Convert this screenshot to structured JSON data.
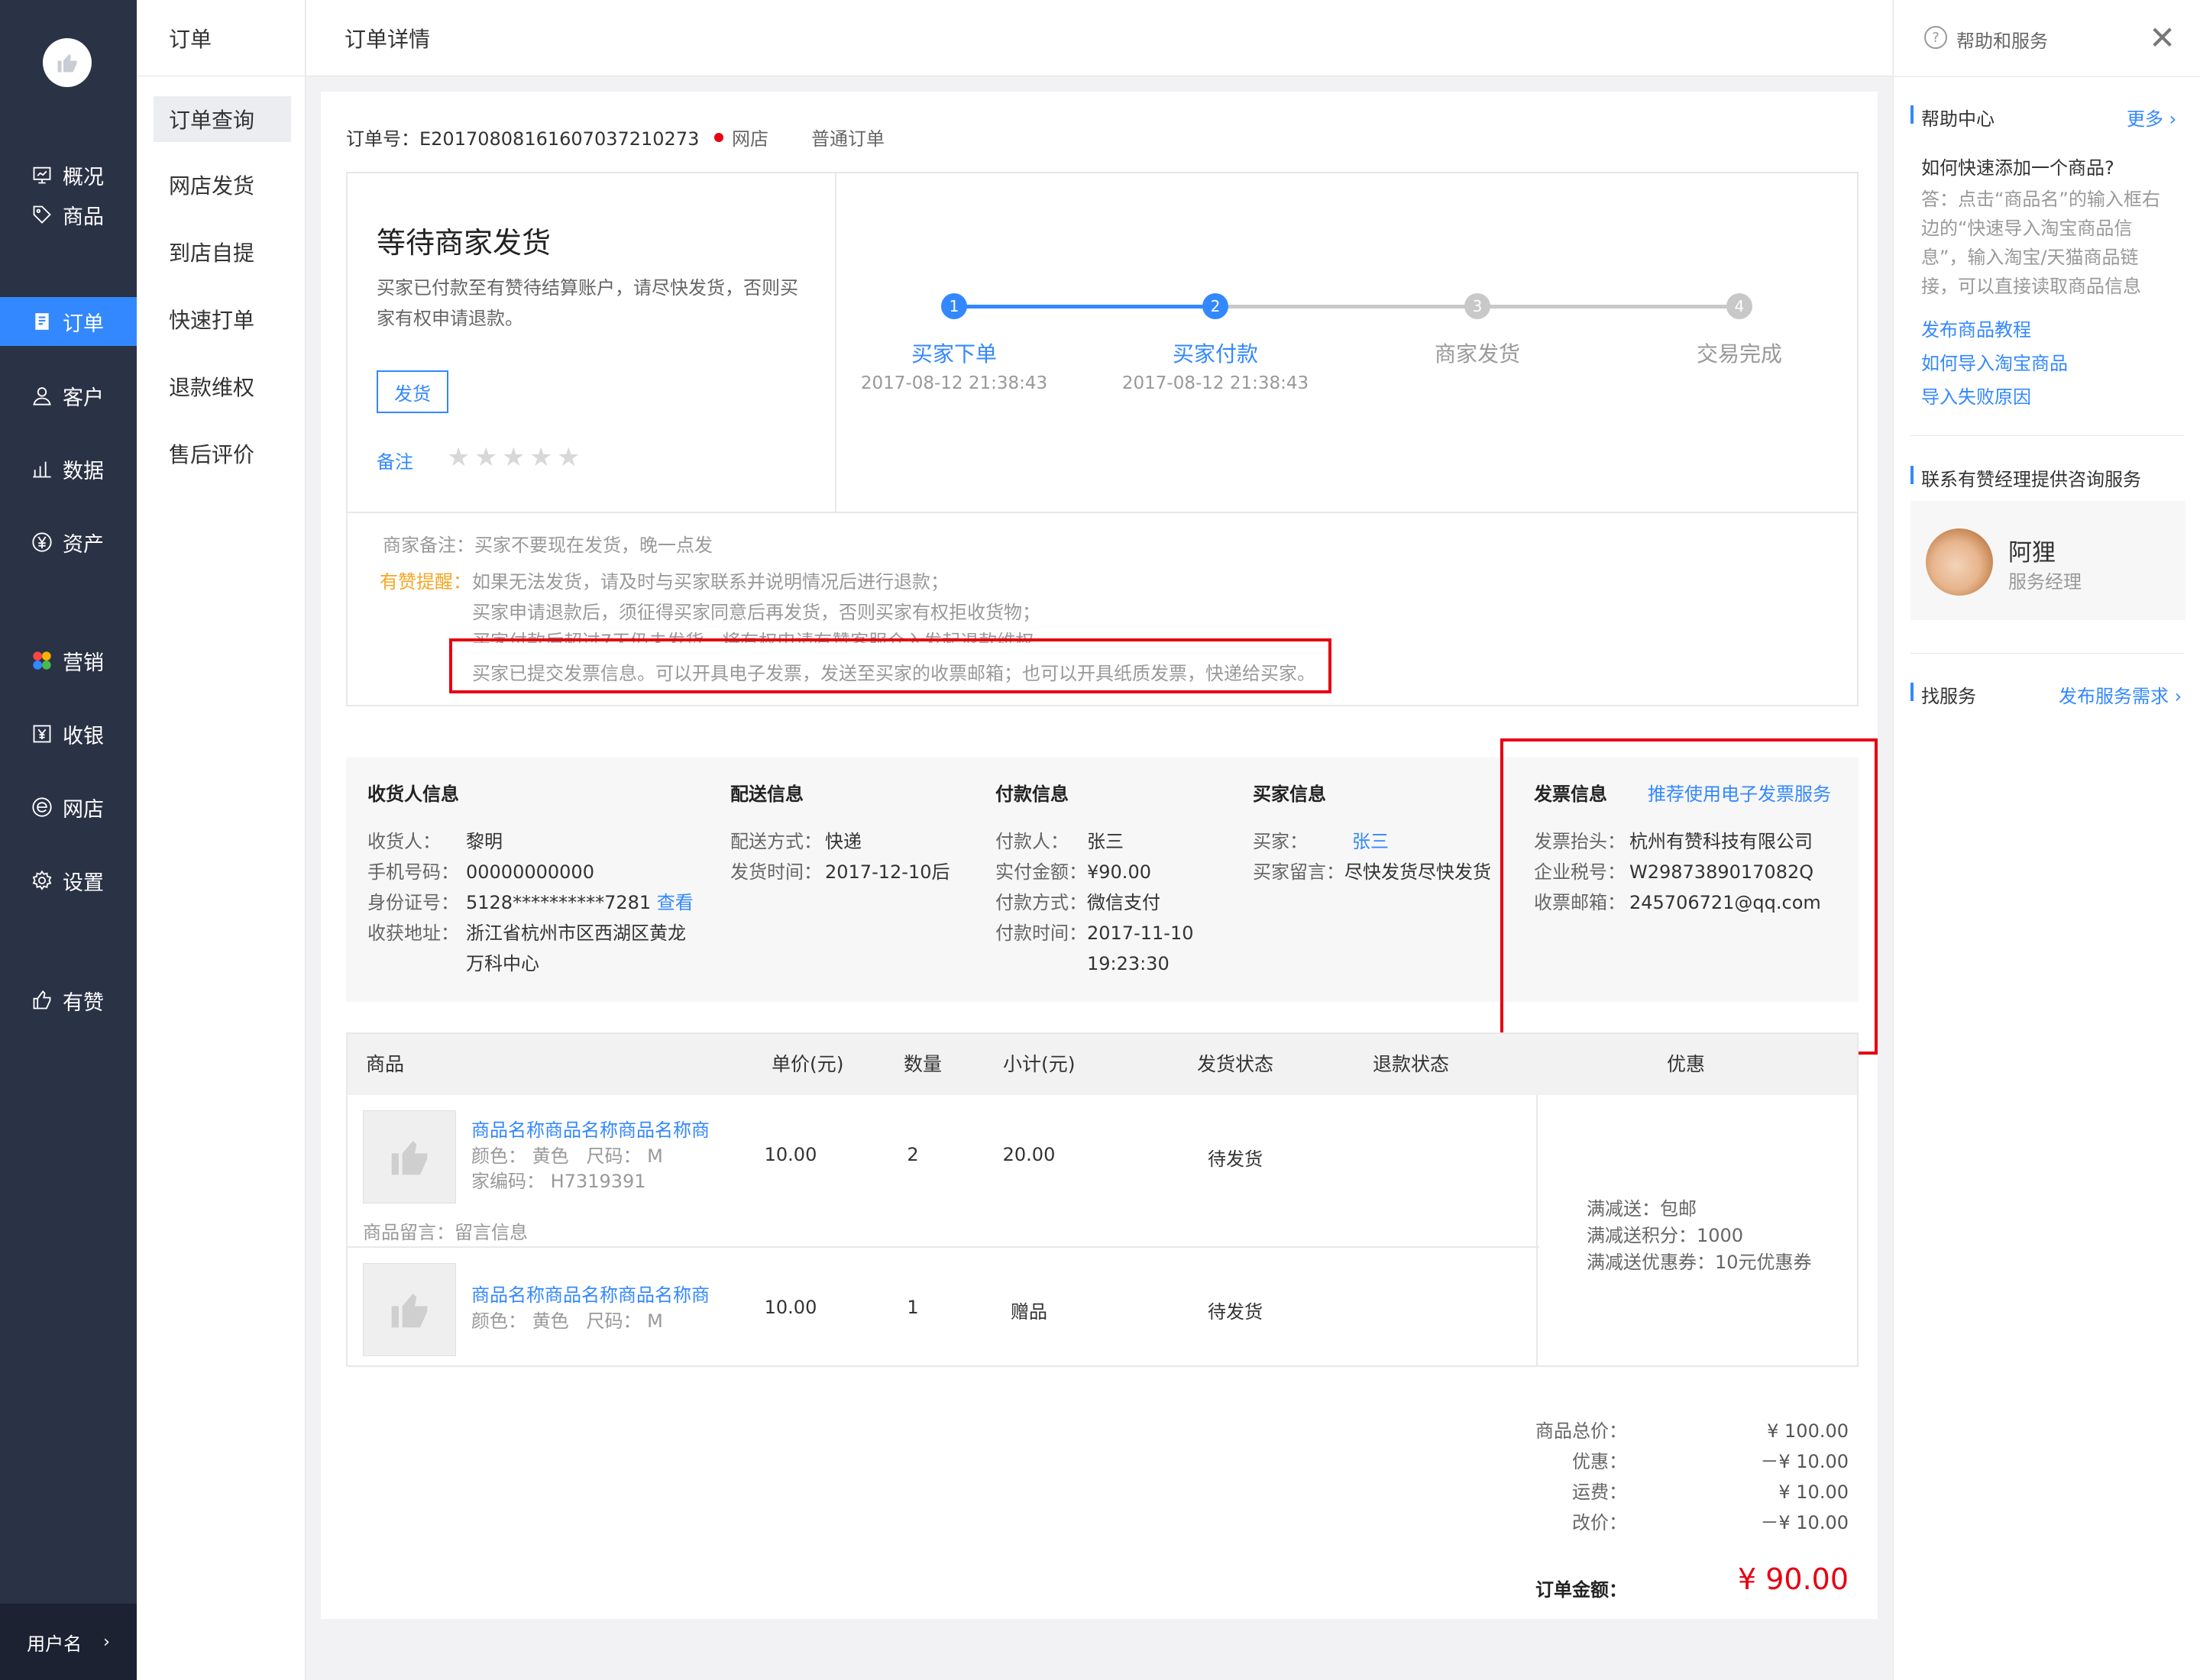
{
  "app": {
    "user_name": "用户名"
  },
  "nav": {
    "items": [
      {
        "label": "概况",
        "icon": "monitor-icon"
      },
      {
        "label": "商品",
        "icon": "tag-icon"
      },
      {
        "label": "订单",
        "icon": "order-icon"
      },
      {
        "label": "客户",
        "icon": "user-icon"
      },
      {
        "label": "数据",
        "icon": "bar-chart-icon"
      },
      {
        "label": "资产",
        "icon": "yen-icon"
      },
      {
        "label": "营销",
        "icon": "apps-icon"
      },
      {
        "label": "收银",
        "icon": "cashier-icon"
      },
      {
        "label": "网店",
        "icon": "store-icon"
      },
      {
        "label": "设置",
        "icon": "gear-icon"
      },
      {
        "label": "有赞",
        "icon": "thumb-up-icon"
      }
    ]
  },
  "subnav": {
    "title": "订单",
    "items": [
      "订单查询",
      "网店发货",
      "到店自提",
      "快速打单",
      "退款维权",
      "售后评价"
    ]
  },
  "page": {
    "title": "订单详情"
  },
  "order": {
    "number_label": "订单号：",
    "number": "E20170808161607037210273",
    "channel": "网店",
    "type": "普通订单"
  },
  "status": {
    "title": "等待商家发货",
    "desc_line1": "买家已付款至有赞待结算账户，请尽快发货，否则买",
    "desc_line2": "家有权申请退款。",
    "ship_button": "发货",
    "remark_link": "备注",
    "rating": 0
  },
  "steps": [
    {
      "num": "1",
      "label": "买家下单",
      "time": "2017-08-12 21:38:43"
    },
    {
      "num": "2",
      "label": "买家付款",
      "time": "2017-08-12 21:38:43"
    },
    {
      "num": "3",
      "label": "商家发货",
      "time": ""
    },
    {
      "num": "4",
      "label": "交易完成",
      "time": ""
    }
  ],
  "notes": {
    "merchant_label": "商家备注：",
    "merchant_text": "买家不要现在发货，晚一点发",
    "tip_label": "有赞提醒：",
    "tip1": "如果无法发货，请及时与买家联系并说明情况后进行退款；",
    "tip2": "买家申请退款后，须征得买家同意后再发货，否则买家有权拒收货物；",
    "tip3": "买家付款后超过7天仍未发货，将有权申请有赞客服介入发起退款维权",
    "tip4": "买家已提交发票信息。可以开具电子发票，发送至买家的收票邮箱；也可以开具纸质发票，快递给买家。"
  },
  "info": {
    "receiver": {
      "title": "收货人信息",
      "name_label": "收货人：",
      "name": "黎明",
      "phone_label": "手机号码：",
      "phone": "00000000000",
      "id_label": "身份证号：",
      "id": "5128**********7281",
      "id_link": "查看",
      "addr_label": "收获地址：",
      "addr1": "浙江省杭州市区西湖区黄龙",
      "addr2": "万科中心"
    },
    "delivery": {
      "title": "配送信息",
      "method_label": "配送方式：",
      "method": "快递",
      "time_label": "发货时间：",
      "time": "2017-12-10后"
    },
    "payment": {
      "title": "付款信息",
      "payer_label": "付款人：",
      "payer": "张三",
      "amount_label": "实付金额：",
      "amount": "¥90.00",
      "method_label": "付款方式：",
      "method": "微信支付",
      "time_label": "付款时间：",
      "time1": "2017-11-10",
      "time2": "19:23:30"
    },
    "buyer": {
      "title": "买家信息",
      "buyer_label": "买家：",
      "buyer": "张三",
      "msg_label": "买家留言：",
      "msg": "尽快发货尽快发货"
    },
    "invoice": {
      "title": "发票信息",
      "link": "推荐使用电子发票服务",
      "head_label": "发票抬头：",
      "head": "杭州有赞科技有限公司",
      "tax_label": "企业税号：",
      "tax": "W2987389017082Q",
      "email_label": "收票邮箱：",
      "email": "245706721@qq.com"
    }
  },
  "table": {
    "headers": [
      "商品",
      "单价(元)",
      "数量",
      "小计(元)",
      "发货状态",
      "退款状态",
      "优惠"
    ],
    "rows": [
      {
        "name": "商品名称商品名称商品名称商",
        "color": "颜色：  黄色",
        "size": "尺码：  M",
        "code": "家编码：  H7319391",
        "msg_label": "商品留言：",
        "msg": "留言信息",
        "price": "10.00",
        "qty": "2",
        "subtotal": "20.00",
        "ship": "待发货"
      },
      {
        "name": "商品名称商品名称商品名称商",
        "color": "颜色：  黄色",
        "size": "尺码：  M",
        "price": "10.00",
        "qty": "1",
        "subtotal": "赠品",
        "ship": "待发货"
      }
    ],
    "promo": [
      "满减送：包邮",
      "满减送积分：1000",
      "满减送优惠券：10元优惠券"
    ]
  },
  "summary": {
    "total_label": "商品总价：",
    "total": "¥ 100.00",
    "discount_label": "优惠：",
    "discount": "－¥ 10.00",
    "shipping_label": "运费：",
    "shipping": "¥ 10.00",
    "adjust_label": "改价：",
    "adjust": "－¥ 10.00",
    "order_label": "订单金额：",
    "order_amount": "¥ 90.00"
  },
  "help": {
    "title": "帮助和服务",
    "center_title": "帮助中心",
    "more": "更多",
    "q": "如何快速添加一个商品?",
    "a1": "答：点击“商品名”的输入框右",
    "a2": "边的“快速导入淘宝商品信",
    "a3": "息”，输入淘宝/天猫商品链",
    "a4": "接，可以直接读取商品信息",
    "links": [
      "发布商品教程",
      "如何导入淘宝商品",
      "导入失败原因"
    ],
    "manager_title": "联系有赞经理提供咨询服务",
    "manager_name": "阿狸",
    "manager_role": "服务经理",
    "service_title": "找服务",
    "service_link": "发布服务需求"
  },
  "colors": {
    "sidebar": "#2a3245",
    "accent": "#3388ff",
    "danger": "#e60012",
    "warn": "#f5a623"
  }
}
